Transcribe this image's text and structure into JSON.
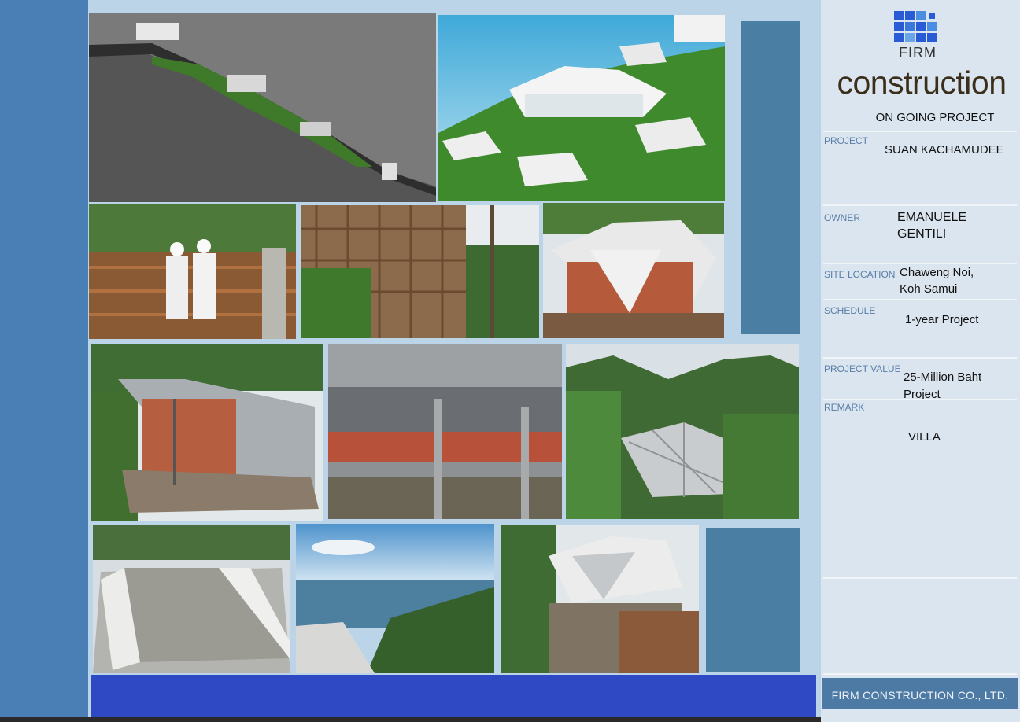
{
  "brand": {
    "logo_text": "FIRM",
    "title": "construction",
    "subtitle": "ON GOING PROJECT"
  },
  "info": {
    "project_label": "PROJECT",
    "project_value": "SUAN KACHAMUDEE",
    "owner_label": "OWNER",
    "owner_line1": "EMANUELE",
    "owner_line2": "GENTILI",
    "site_label": "SITE LOCATION",
    "site_line1": "Chaweng Noi,",
    "site_line2": "Koh Samui",
    "schedule_label": "SCHEDULE",
    "schedule_value": "1-year Project",
    "value_label": "PROJECT VALUE",
    "value_line1": "25-Million Baht",
    "value_line2": "Project",
    "remark_label": "REMARK",
    "remark_value": "VILLA"
  },
  "footer": {
    "company": "FIRM CONSTRUCTION CO., LTD."
  },
  "colors": {
    "accent_blue": "#4a7fb6",
    "panel_blue": "#4a7ea3",
    "bar_blue": "#2f49c4",
    "title_brown": "#3b2e1a"
  }
}
